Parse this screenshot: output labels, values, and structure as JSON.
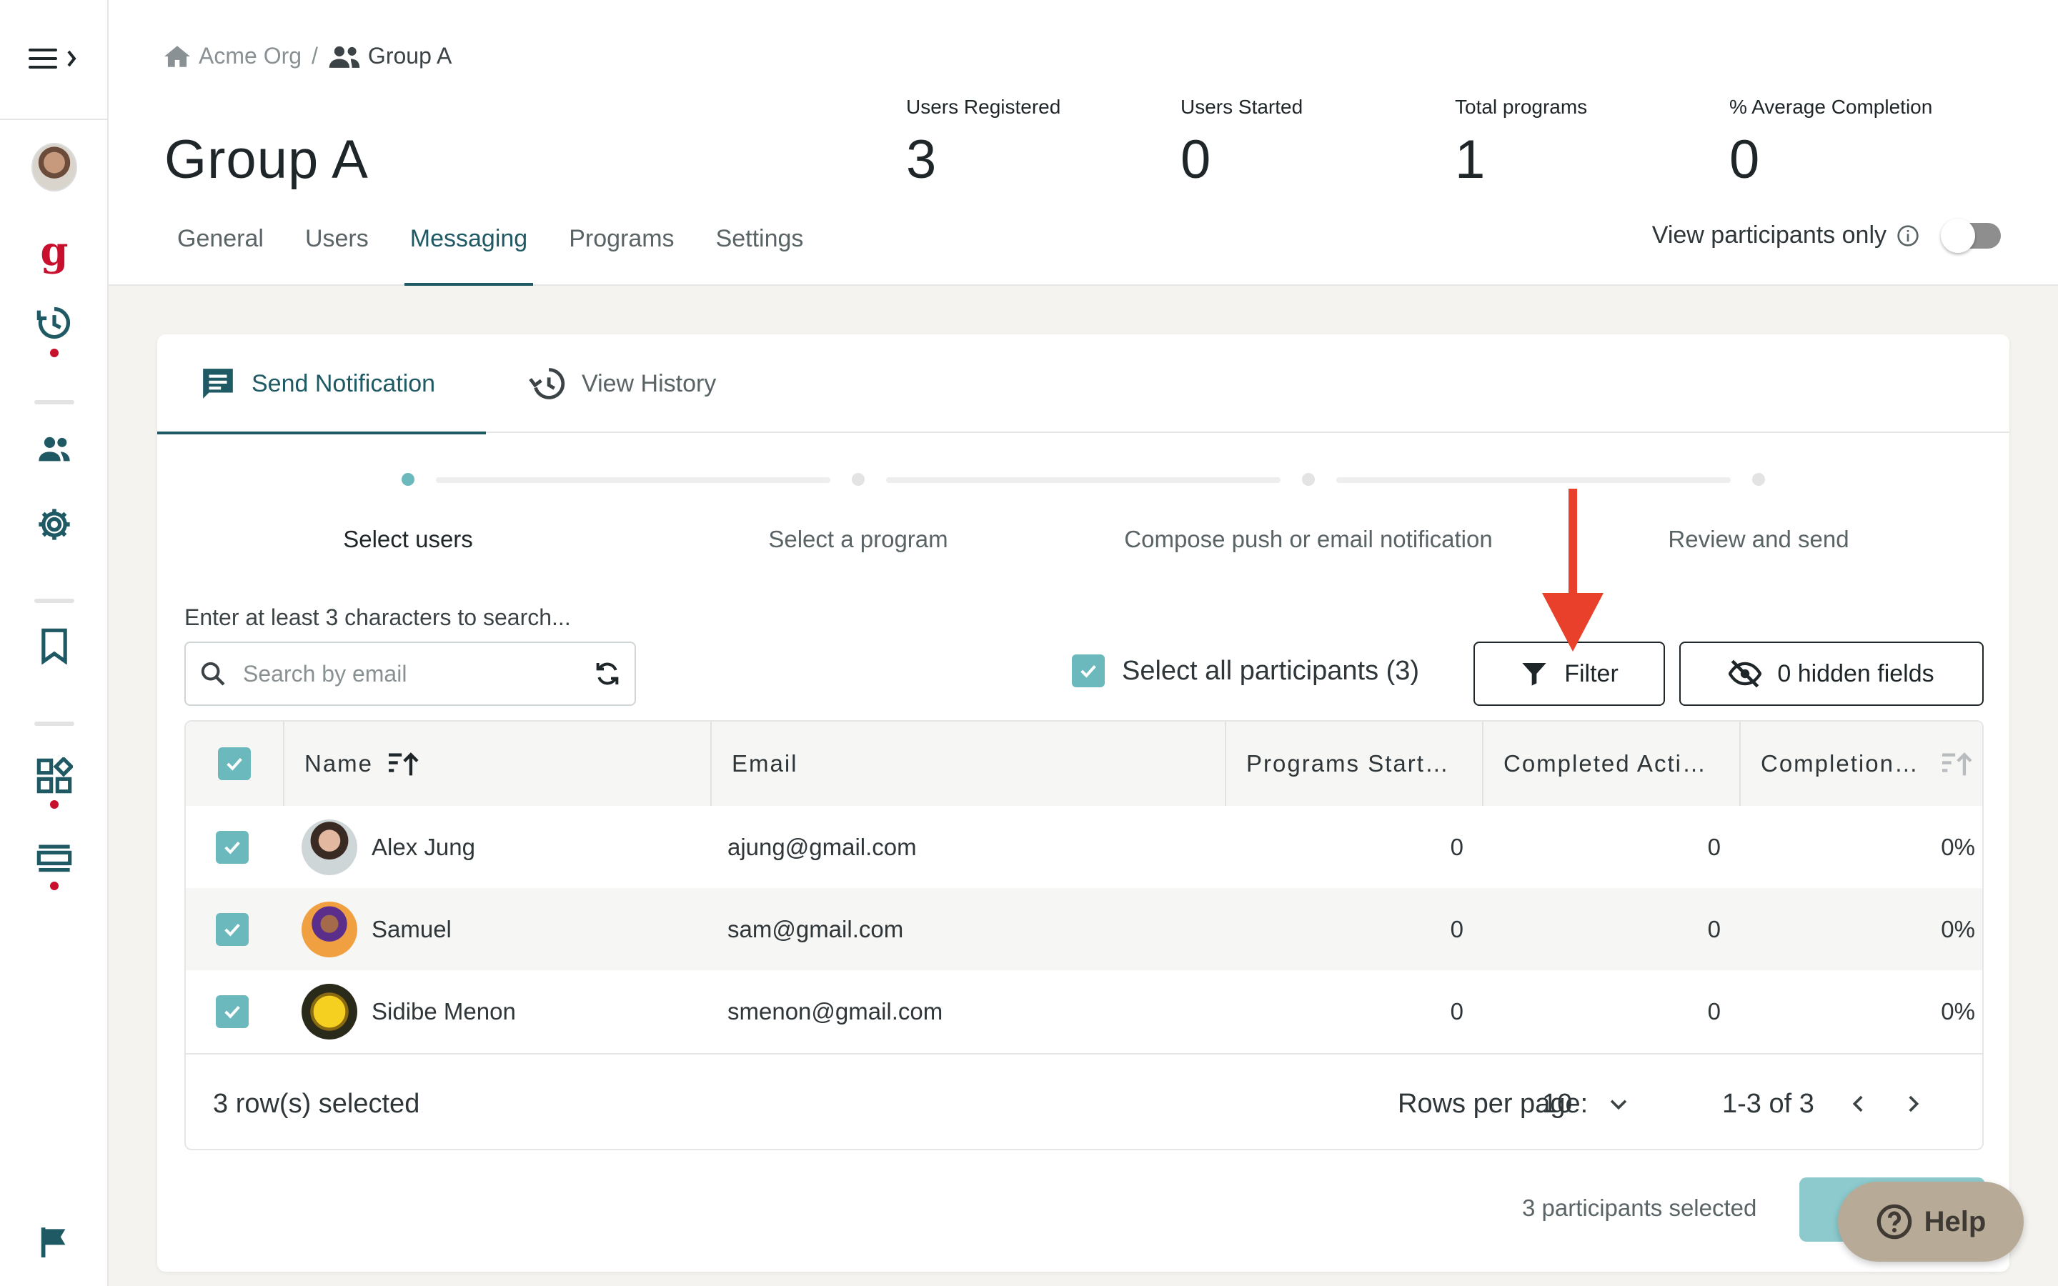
{
  "sidebar": {
    "toggle_icon": "menu-expand-icon",
    "logo_letter": "g",
    "icons": [
      "avatar",
      "g-logo",
      "history-icon",
      "users-icon",
      "gear-icon",
      "bookmark-icon",
      "apps-icon",
      "list-icon",
      "flag-icon"
    ],
    "accent_color": "#c8102e",
    "icon_color": "#1f5a64"
  },
  "breadcrumb": {
    "org": "Acme Org",
    "separator": "/",
    "group": "Group A"
  },
  "page": {
    "title": "Group A"
  },
  "stats": [
    {
      "label": "Users Registered",
      "value": "3"
    },
    {
      "label": "Users Started",
      "value": "0"
    },
    {
      "label": "Total programs",
      "value": "1"
    },
    {
      "label": "% Average Completion",
      "value": "0"
    }
  ],
  "tabs": [
    {
      "label": "General"
    },
    {
      "label": "Users"
    },
    {
      "label": "Messaging",
      "active": true
    },
    {
      "label": "Programs"
    },
    {
      "label": "Settings"
    }
  ],
  "view_participants": {
    "label": "View participants only",
    "enabled": false
  },
  "card_tabs": [
    {
      "label": "Send Notification",
      "active": true
    },
    {
      "label": "View History"
    }
  ],
  "stepper": [
    {
      "label": "Select users",
      "active": true
    },
    {
      "label": "Select a program"
    },
    {
      "label": "Compose push or email notification"
    },
    {
      "label": "Review and send"
    }
  ],
  "search": {
    "hint": "Enter at least 3 characters to search...",
    "placeholder": "Search by email",
    "value": ""
  },
  "select_all": {
    "label": "Select all participants (3)",
    "checked": true
  },
  "buttons": {
    "filter": "Filter",
    "hidden_fields": "0 hidden fields"
  },
  "table": {
    "columns": [
      "Name",
      "Email",
      "Programs Start…",
      "Completed Acti…",
      "Completion…"
    ],
    "rows": [
      {
        "name": "Alex Jung",
        "email": "ajung@gmail.com",
        "programs_started": "0",
        "completed": "0",
        "completion": "0%",
        "checked": true
      },
      {
        "name": "Samuel",
        "email": "sam@gmail.com",
        "programs_started": "0",
        "completed": "0",
        "completion": "0%",
        "checked": true
      },
      {
        "name": "Sidibe Menon",
        "email": "smenon@gmail.com",
        "programs_started": "0",
        "completed": "0",
        "completion": "0%",
        "checked": true
      }
    ],
    "footer": {
      "selected_text": "3 row(s) selected",
      "rows_per_page_label": "Rows per page:",
      "rows_per_page_value": "10",
      "range": "1-3 of 3"
    }
  },
  "participants_selected": "3 participants selected",
  "help": {
    "label": "Help"
  },
  "colors": {
    "teal": "#6cb9bd",
    "dark_teal": "#1f5a64",
    "arrow_red": "#e8402a"
  }
}
